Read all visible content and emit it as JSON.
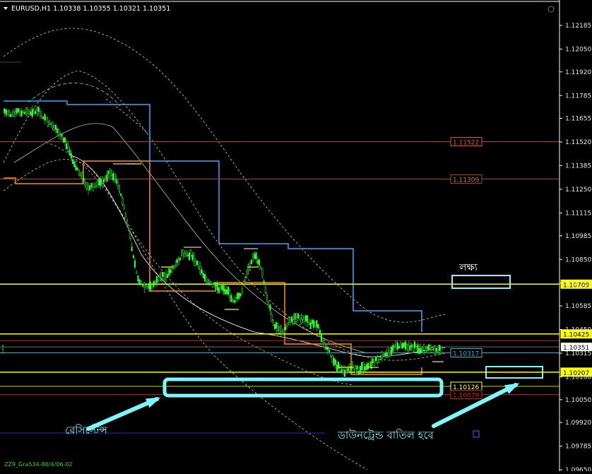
{
  "header": {
    "symbol_text": "EURUSD,H1  1.10338 1.10355 1.10321 1.10351"
  },
  "price_axis": {
    "ticks": [
      "1.12185",
      "1.12050",
      "1.11920",
      "1.11785",
      "1.11655",
      "1.11520",
      "1.11385",
      "1.11250",
      "1.11115",
      "1.10985",
      "1.10850",
      "1.10715",
      "1.10585",
      "1.10450",
      "1.10315",
      "1.10180",
      "1.10050",
      "1.09920",
      "1.09785",
      "1.09650"
    ]
  },
  "level_lines": [
    {
      "price": 1.11522,
      "label": "1.11522",
      "color": "#c0392b",
      "label_border": "#e74c3c",
      "label_text": "#e74c3c",
      "tag_fill": "#000000",
      "on_axis": false
    },
    {
      "price": 1.11309,
      "label": "1.11309",
      "color": "#a0522d",
      "label_border": "#a0522d",
      "label_text": "#c8703a",
      "tag_fill": "#000000",
      "on_axis": false
    },
    {
      "price": 1.10709,
      "label": "1.10709",
      "color": "#ffff00",
      "label_border": "#ffff00",
      "label_text": "#000000",
      "tag_fill": "#ffff00",
      "on_axis": true
    },
    {
      "price": 1.10425,
      "label": "1.10425",
      "color": "#ffff00",
      "label_border": "#ffff00",
      "label_text": "#000000",
      "tag_fill": "#ffff00",
      "on_axis": true
    },
    {
      "price": 1.10317,
      "label": "1.10317",
      "color": "#3ab0d0",
      "label_border": "#3ab0d0",
      "label_text": "#3ab0d0",
      "tag_fill": "#000000",
      "on_axis": false
    },
    {
      "price": 1.10207,
      "label": "1.10207",
      "color": "#ffff00",
      "label_border": "#ffff00",
      "label_text": "#000000",
      "tag_fill": "#ffff00",
      "on_axis": true
    },
    {
      "price": 1.10126,
      "label": "1.10126",
      "color": "#cccc00",
      "label_border": "#ffff66",
      "label_text": "#ffff66",
      "tag_fill": "#000000",
      "on_axis": false
    },
    {
      "price": 1.10079,
      "label": "1.10079",
      "color": "#cc2222",
      "label_border": "#cc2222",
      "label_text": "#cc2222",
      "tag_fill": "#000000",
      "on_axis": false
    }
  ],
  "current_price": {
    "price": 1.10351,
    "label": "1.10351"
  },
  "annotations": {
    "target_label": "লক্ষ্য",
    "resistance_label": "রেসিস্টেন্স",
    "downtrend_label": "ডাউনট্রেন্ড বাতিল হবে"
  },
  "footer": {
    "watermark": "ZZ9_Gra534-86/4/06-02"
  },
  "colors": {
    "background": "#000000",
    "candle": "#33ff33",
    "cyan_annotation": "#7ff5ff",
    "orange_channel": "#ff8c1a",
    "blue_channel": "#3aa8ff",
    "yellow_level": "#ffff00"
  }
}
